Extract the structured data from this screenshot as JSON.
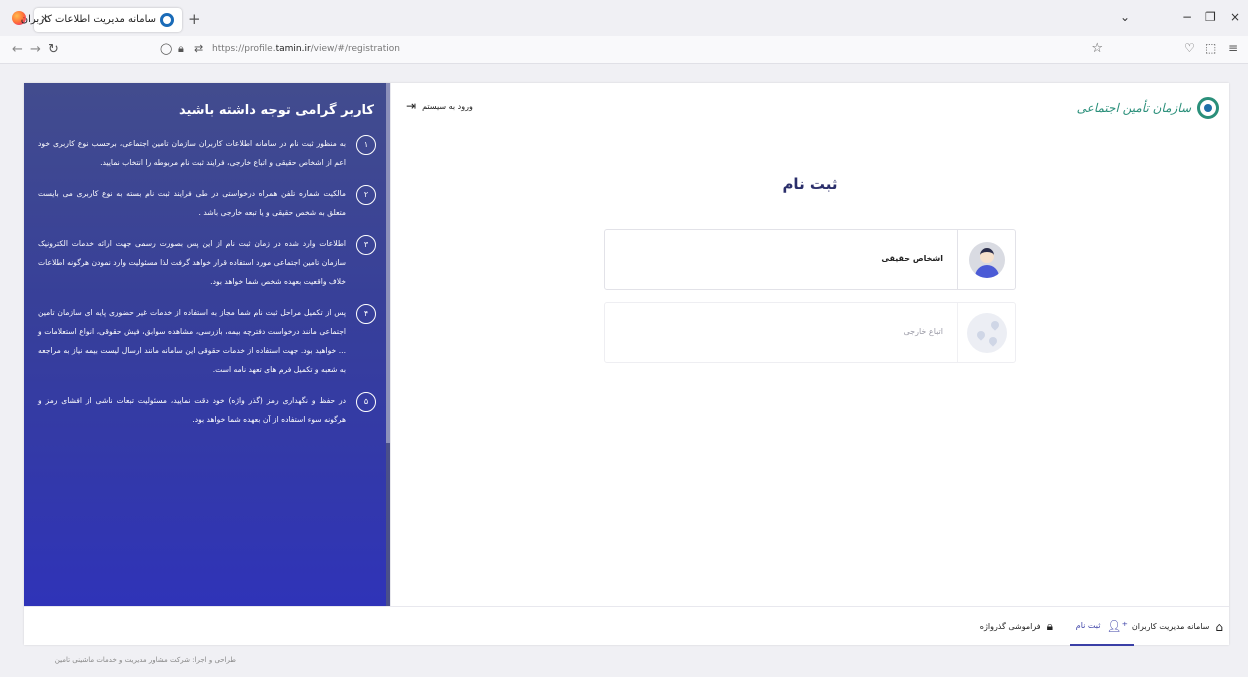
{
  "browser": {
    "tab_title": "سامانه مدیریت اطلاعات کاربران",
    "tab_close": "×",
    "new_tab": "+",
    "controls": {
      "list": "⌄",
      "minimize": "−",
      "maximize": "❐",
      "close": "×"
    },
    "url": {
      "prefix": "https://profile.",
      "domain": "tamin.ir",
      "path": "/view/#/registration"
    }
  },
  "info_panel": {
    "title": "کاربر گرامی توجه داشته باشید",
    "items": [
      {
        "num": "۱",
        "text": "به منظور ثبت نام در سامانه اطلاعات کاربران سازمان تامین اجتماعی، برحسب نوع کاربری خود اعم از اشخاص حقیقی و اتباع خارجی، فرایند ثبت نام مربوطه را انتخاب نمایید."
      },
      {
        "num": "۲",
        "text": "مالکیت شماره تلفن همراه درخواستی در طی فرایند ثبت نام بسته به نوع کاربری می بایست متعلق به شخص حقیقی و یا تبعه خارجی باشد ."
      },
      {
        "num": "۳",
        "text": "اطلاعات وارد شده در زمان ثبت نام از این پس بصورت رسمی جهت ارائه خدمات الکترونیک سازمان تامین اجتماعی مورد استفاده قرار خواهد گرفت لذا مسئولیت وارد نمودن هرگونه اطلاعات خلاف واقعیت بعهده شخص شما خواهد بود."
      },
      {
        "num": "۴",
        "text": "پس از تکمیل مراحل ثبت نام شما مجاز به استفاده از خدمات غیر حضوری پایه ای سازمان تامین اجتماعی مانند درخواست دفترچه بیمه، بازرسی، مشاهده سوابق، فیش حقوقی، انواع استعلامات و ... خواهید بود. جهت استفاده از خدمات حقوقی این سامانه مانند ارسال لیست بیمه نیاز به مراجعه به شعبه و تکمیل فرم های تعهد نامه است."
      },
      {
        "num": "۵",
        "text": "در حفظ و نگهداری رمز (گذر واژه) خود دقت نمایید، مسئولیت تبعات ناشی از افشای رمز و هرگونه سوء استفاده از آن بعهده شما خواهد بود."
      }
    ]
  },
  "main": {
    "logo_text": "سازمان تأمین اجتماعی",
    "login_link": "ورود به سیستم",
    "page_title": "ثبت نام",
    "options": [
      {
        "label": "اشخاص حقیقی",
        "icon": "user-avatar-icon",
        "enabled": true
      },
      {
        "label": "اتباع خارجی",
        "icon": "map-pin-icon",
        "enabled": false
      }
    ]
  },
  "bottom_nav": {
    "home": "سامانه مدیریت کاربران",
    "register": "ثبت نام",
    "forgot": "فراموشی گذرواژه"
  },
  "footer": "طراحی و اجرا: شرکت مشاور مدیریت و خدمات ماشینی تامین",
  "colors": {
    "panel": "#373f9a",
    "accent": "#3a3fa6",
    "title": "#2b2f6b"
  }
}
